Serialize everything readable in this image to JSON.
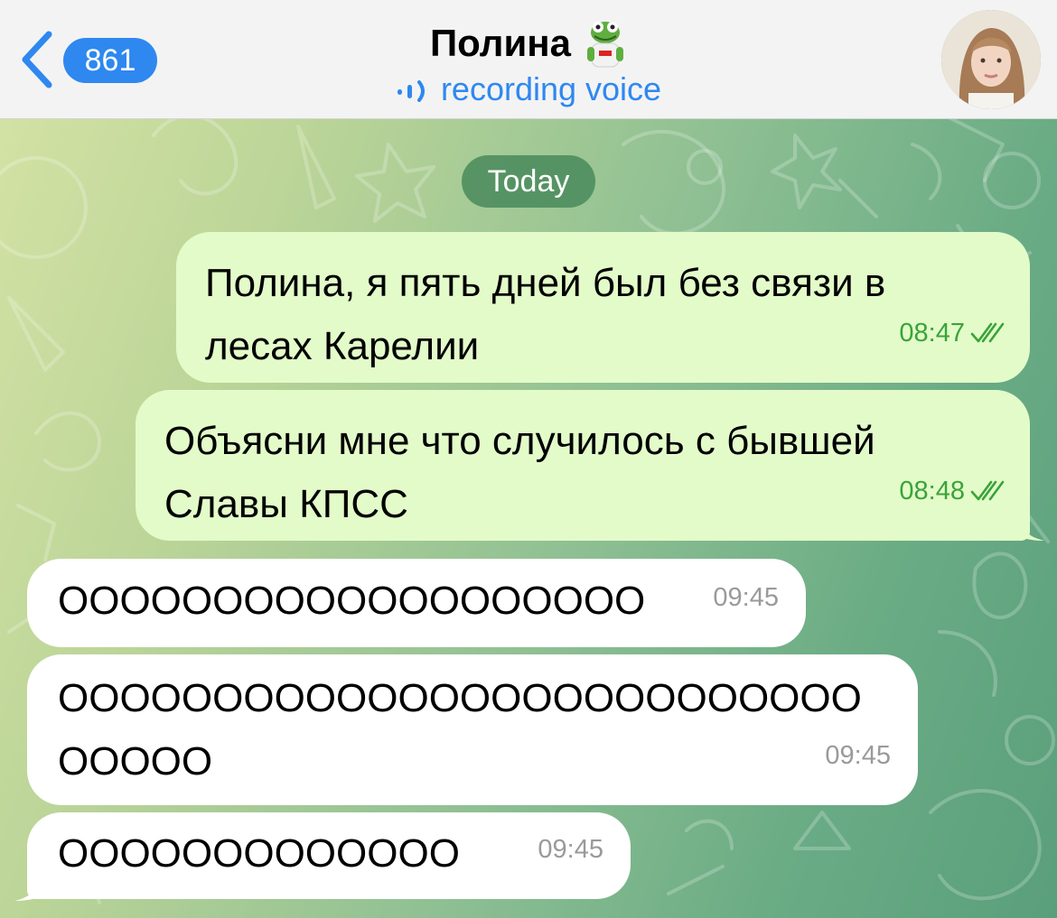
{
  "header": {
    "back_count": "861",
    "title": "Полина",
    "status": "recording voice"
  },
  "date_chip": "Today",
  "messages": [
    {
      "direction": "out",
      "text": "Полина, я пять дней был без связи в\nлесах Карелии",
      "time": "08:47",
      "read": true
    },
    {
      "direction": "out",
      "text": "Объясни мне что случилось с бывшей\nСлавы КПСС",
      "time": "08:48",
      "read": true
    },
    {
      "direction": "in",
      "text": "ООООООООООООООООООО",
      "time": "09:45"
    },
    {
      "direction": "in",
      "text": "ОООООООООООООООООООООООООО\nООООО",
      "time": "09:45"
    },
    {
      "direction": "in",
      "text": "ООООООООООООО",
      "time": "09:45"
    }
  ],
  "colors": {
    "accent": "#2e88f0",
    "outgoing_bubble": "#e3fbc9",
    "incoming_bubble": "#ffffff",
    "read_check": "#3aa33a",
    "date_chip": "#498a5c"
  },
  "icons": {
    "back": "chevron-left-icon",
    "status": "recording-wave-icon",
    "title_emoji": "kermit-sticker-icon",
    "read": "double-check-icon"
  }
}
